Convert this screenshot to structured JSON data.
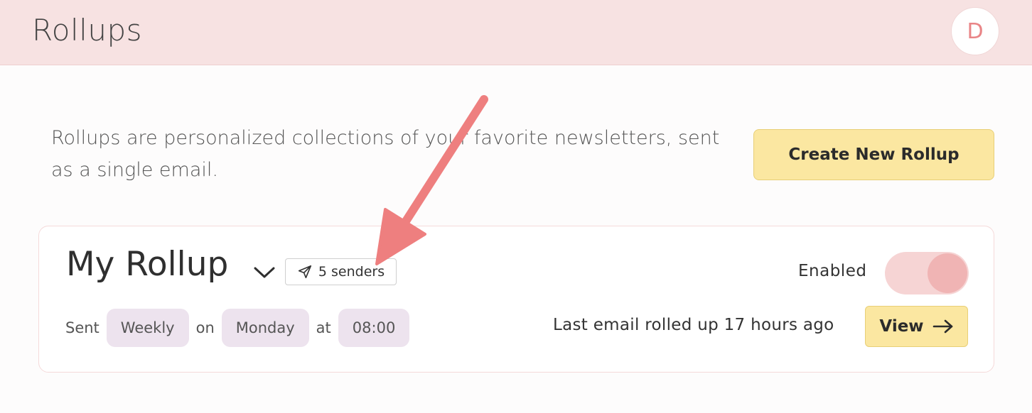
{
  "header": {
    "title": "Rollups",
    "avatar_initial": "D"
  },
  "intro": {
    "text": "Rollups are personalized collections of your favorite newsletters, sent as a single email.",
    "create_button": "Create New Rollup"
  },
  "rollup": {
    "name": "My Rollup",
    "senders_label": "5 senders",
    "enabled_label": "Enabled",
    "enabled": true,
    "schedule": {
      "sent_word": "Sent",
      "frequency": "Weekly",
      "on_word": "on",
      "day": "Monday",
      "at_word": "at",
      "time": "08:00"
    },
    "last_email": "Last email rolled up 17 hours ago",
    "view_button": "View"
  },
  "annotation": {
    "color": "#ee7f7f"
  }
}
